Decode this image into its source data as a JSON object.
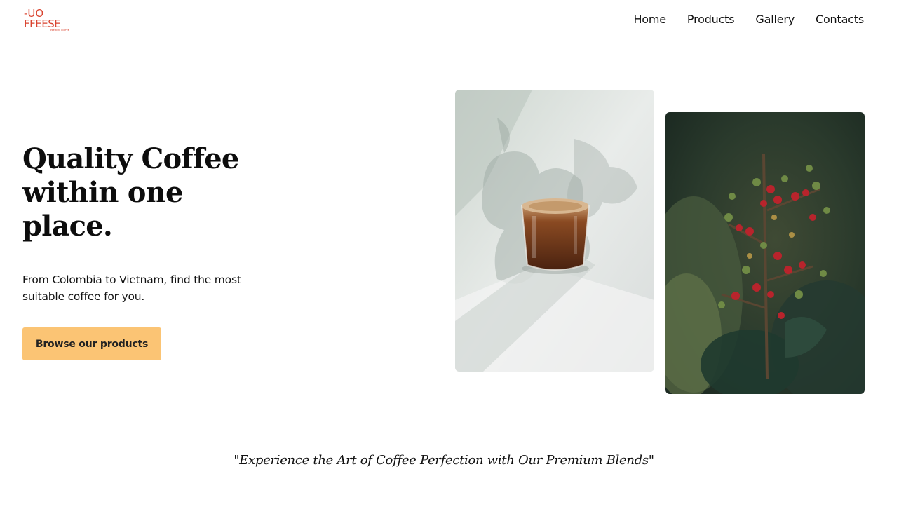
{
  "brand": {
    "logo_line1": "-UO",
    "logo_line2": "FFEESE",
    "logo_tagline": "PREMIUM COFFEE",
    "accent_color": "#d9432f"
  },
  "nav": {
    "items": [
      "Home",
      "Products",
      "Gallery",
      "Contacts"
    ]
  },
  "hero": {
    "title": "Quality Coffee within one place.",
    "subtitle": "From Colombia to Vietnam, find the most suitable coffee for you.",
    "cta_label": "Browse our products",
    "cta_color": "#fbc474"
  },
  "images": {
    "first": "coffee-glass-photo",
    "second": "coffee-cherries-photo"
  },
  "quote": {
    "text": "\"Experience the Art of Coffee Perfection with Our Premium Blends\""
  }
}
